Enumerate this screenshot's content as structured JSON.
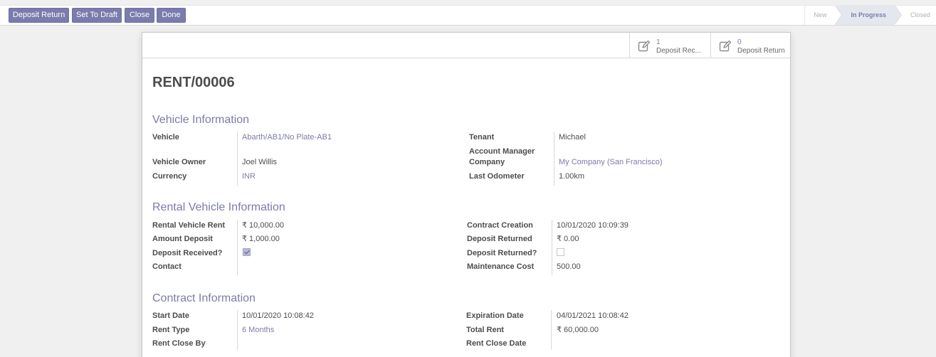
{
  "header": {
    "buttons": [
      "Deposit Return",
      "Set To Draft",
      "Close",
      "Done"
    ],
    "stages": [
      "New",
      "In Progress",
      "Closed"
    ],
    "active_stage": "In Progress"
  },
  "smart_buttons": [
    {
      "count": "1",
      "label": "Deposit Rec...",
      "icon": "edit-icon"
    },
    {
      "count": "0",
      "label": "Deposit Return",
      "icon": "edit-icon"
    }
  ],
  "record": {
    "name": "RENT/00006"
  },
  "sections": {
    "vehicle": {
      "title": "Vehicle Information",
      "vehicle_label": "Vehicle",
      "vehicle": "Abarth/AB1/No Plate-AB1",
      "owner_label": "Vehicle Owner",
      "owner": "Joel Willis",
      "currency_label": "Currency",
      "currency": "INR",
      "tenant_label": "Tenant",
      "tenant": "Michael",
      "account_manager_label": "Account Manager",
      "company_label": "Company",
      "company": "My Company (San Francisco)",
      "odometer_label": "Last Odometer",
      "odometer": "1.00km"
    },
    "rental": {
      "title": "Rental Vehicle Information",
      "rent_label": "Rental Vehicle Rent",
      "rent": "₹ 10,000.00",
      "deposit_label": "Amount Deposit",
      "deposit": "₹ 1,000.00",
      "deposit_received_label": "Deposit Received?",
      "deposit_received": true,
      "contact_label": "Contact",
      "contact": "",
      "contract_creation_label": "Contract Creation",
      "contract_creation": "10/01/2020 10:09:39",
      "deposit_returned_amt_label": "Deposit Returned",
      "deposit_returned_amt": "₹ 0.00",
      "deposit_returned_q_label": "Deposit Returned?",
      "deposit_returned_q": false,
      "maintenance_label": "Maintenance Cost",
      "maintenance": "500.00"
    },
    "contract": {
      "title": "Contract Information",
      "start_label": "Start Date",
      "start": "10/01/2020 10:08:42",
      "rent_type_label": "Rent Type",
      "rent_type": "6 Months",
      "rent_close_by_label": "Rent Close By",
      "rent_close_by": "",
      "expiration_label": "Expiration Date",
      "expiration": "04/01/2021 10:08:42",
      "total_rent_label": "Total Rent",
      "total_rent": "₹ 60,000.00",
      "rent_close_date_label": "Rent Close Date",
      "rent_close_date": ""
    }
  },
  "colors": {
    "accent": "#7c7bad",
    "active_stage_bg": "#e4e8ee"
  }
}
